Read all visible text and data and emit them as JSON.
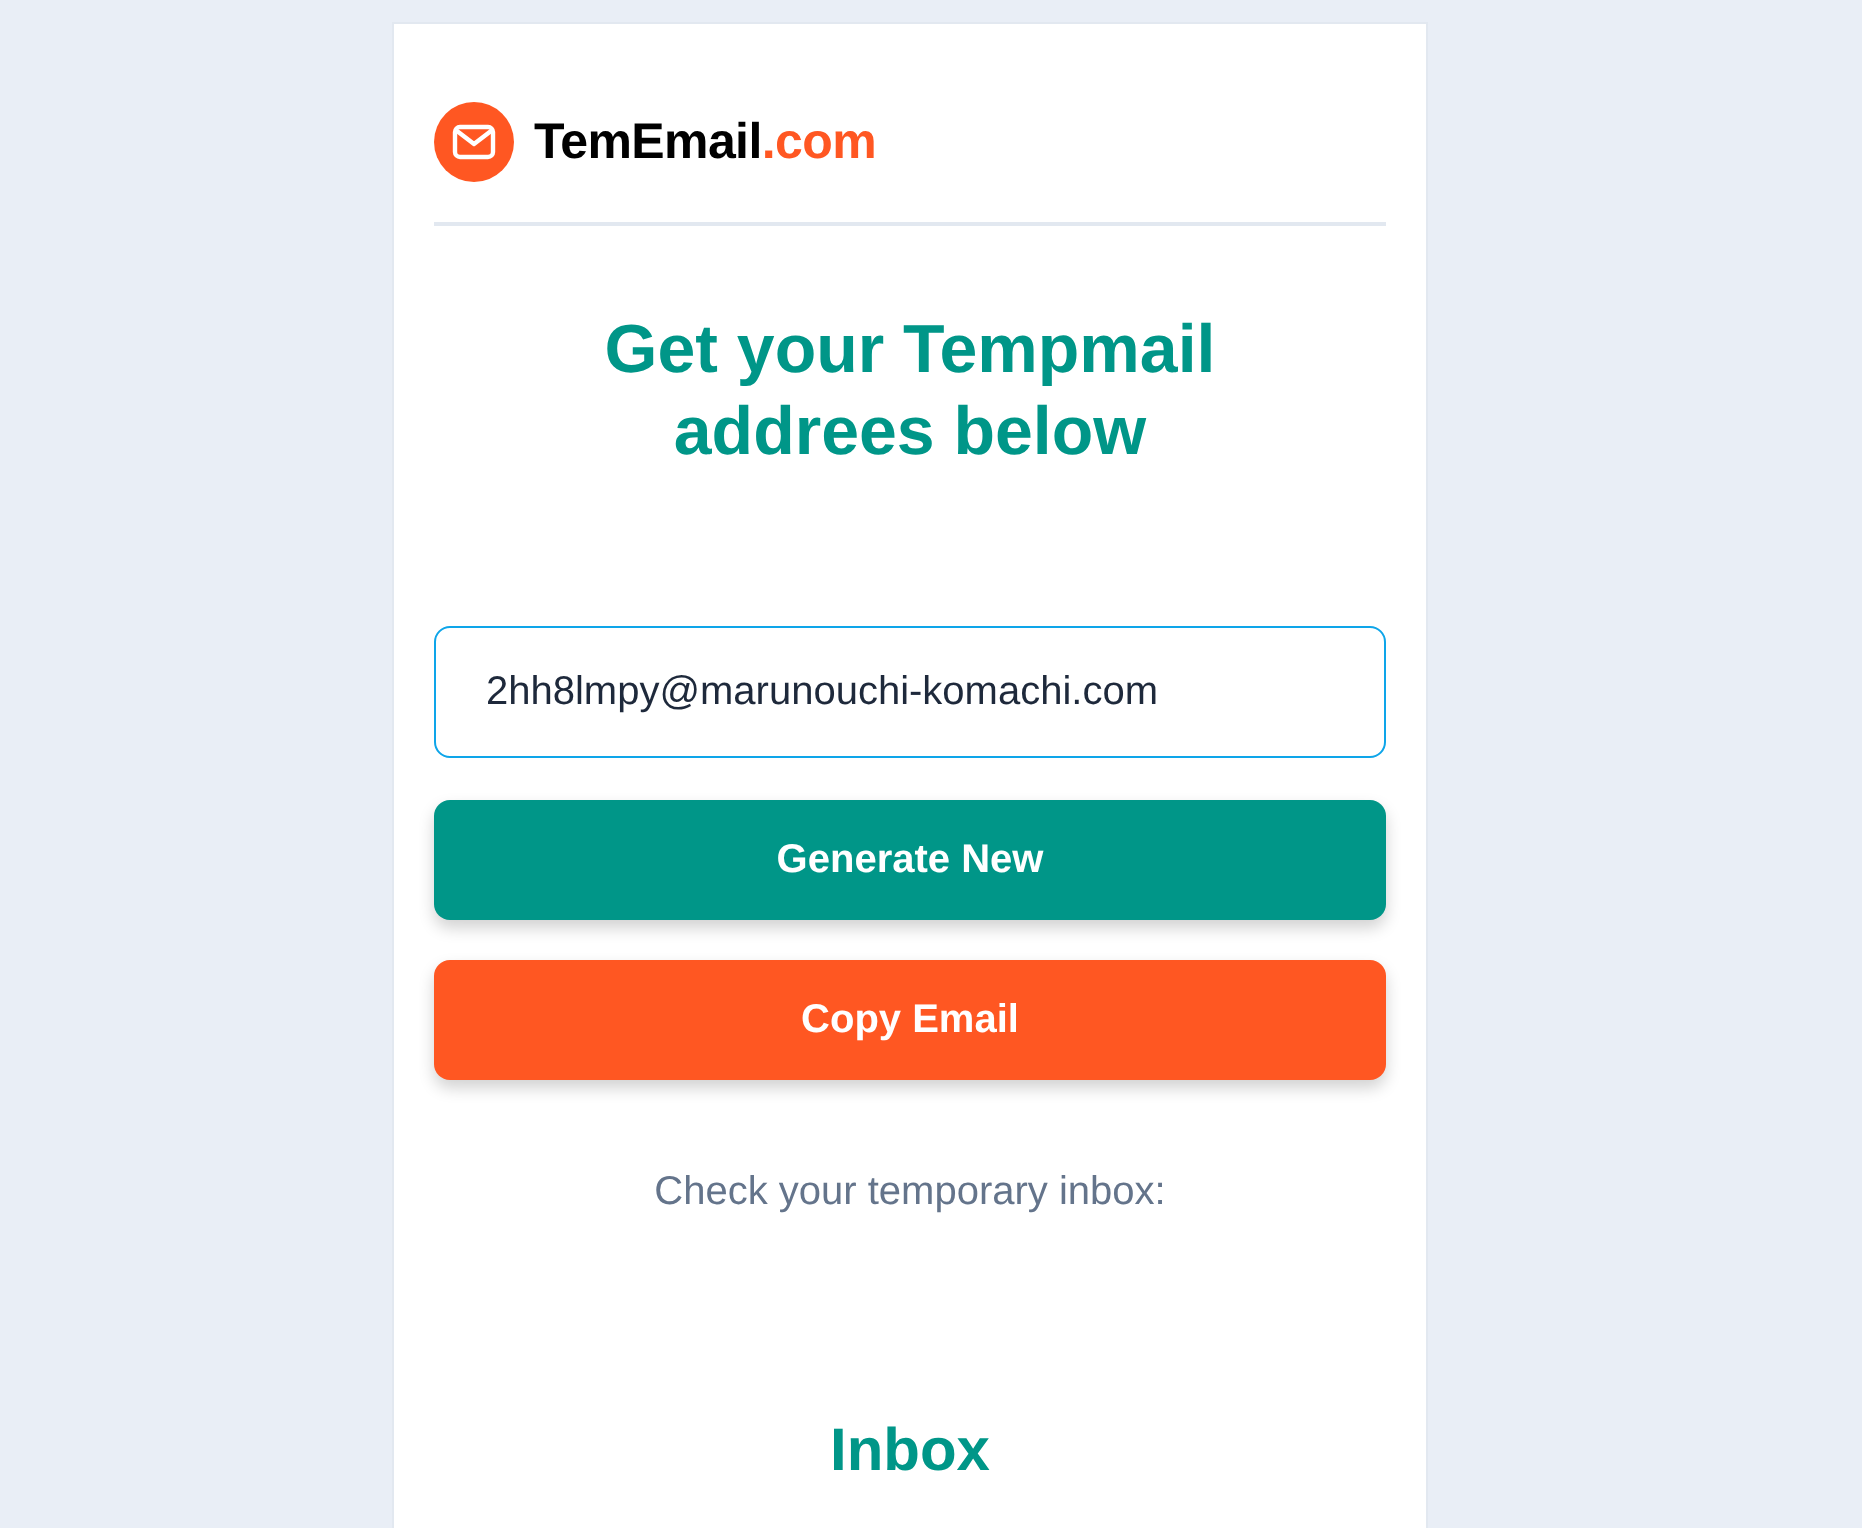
{
  "brand": {
    "name": "TemEmail",
    "suffix": ".com"
  },
  "headline": "Get your Tempmail addrees below",
  "email_field": {
    "value": "2hh8lmpy@marunouchi-komachi.com"
  },
  "buttons": [
    {
      "label": "Generate New",
      "kind": "primary"
    },
    {
      "label": "Copy Email",
      "kind": "accent"
    }
  ],
  "hint": "Check your temporary inbox:",
  "inbox": {
    "title": "Inbox"
  }
}
